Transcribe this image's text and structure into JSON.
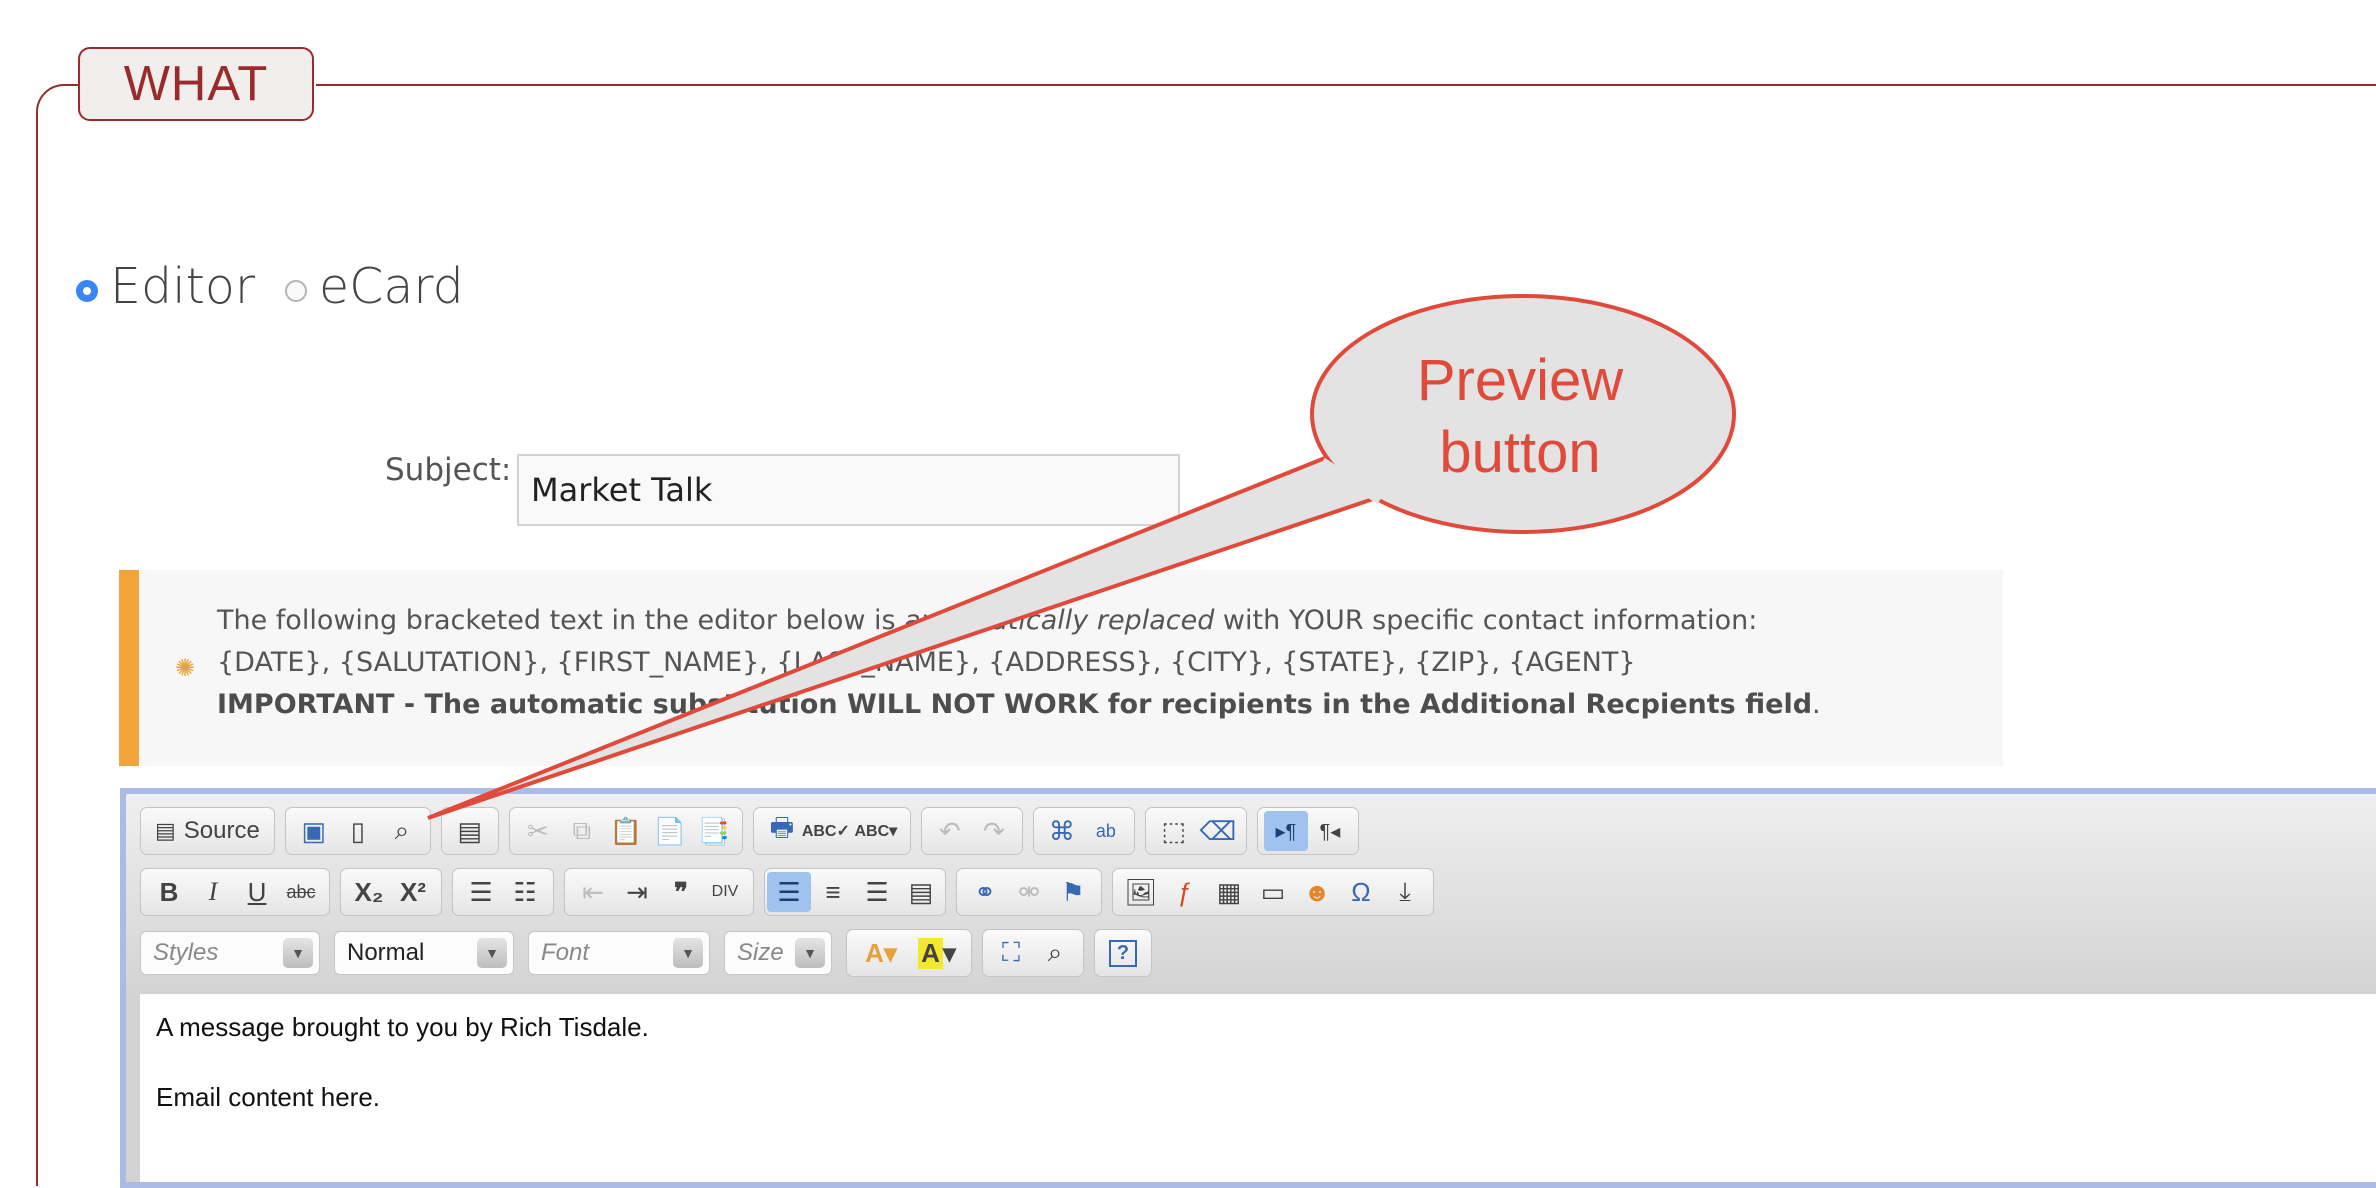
{
  "section": {
    "legend": "WHAT"
  },
  "mode": {
    "options": [
      {
        "label": "Editor",
        "selected": true
      },
      {
        "label": "eCard",
        "selected": false
      }
    ]
  },
  "subject": {
    "label": "Subject:",
    "value": "Market Talk"
  },
  "notice": {
    "line1_before": "The following bracketed text in the editor below is ",
    "line1_italic": "automatically replaced",
    "line1_after": " with YOUR specific contact information:",
    "line2": "{DATE}, {SALUTATION}, {FIRST_NAME}, {LAST_NAME}, {ADDRESS}, {CITY}, {STATE}, {ZIP}, {AGENT}",
    "line3_bold": "IMPORTANT - The automatic substitution WILL NOT WORK for recipients in the Additional Recpients field",
    "line3_end": "."
  },
  "toolbar": {
    "source_label": "Source",
    "styles_placeholder": "Styles",
    "format_value": "Normal",
    "font_placeholder": "Font",
    "size_placeholder": "Size",
    "help_label": "?",
    "colors": {
      "active_button": "#9fc2ef"
    }
  },
  "editor": {
    "lines": [
      "A message brought to you by Rich Tisdale.",
      "Email content here."
    ]
  },
  "annotation": {
    "line1": "Preview",
    "line2": "button",
    "color": "#e04a3a"
  }
}
